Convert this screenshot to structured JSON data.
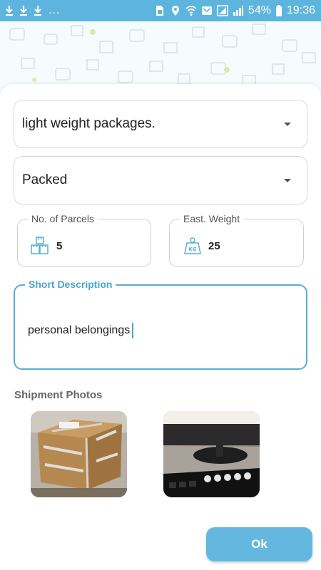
{
  "status_bar": {
    "dots": "...",
    "battery": "54%",
    "time": "19:36"
  },
  "form": {
    "category_select": {
      "value": "light weight packages."
    },
    "status_select": {
      "value": "Packed"
    },
    "parcels": {
      "label": "No. of Parcels",
      "value": "5",
      "icon": "boxes-icon"
    },
    "weight": {
      "label": "East. Weight",
      "value": "25",
      "icon": "kg-weight-icon"
    },
    "description": {
      "label": "Short Description",
      "value": "personal belongings"
    }
  },
  "photos": {
    "label": "Shipment Photos"
  },
  "actions": {
    "ok_label": "Ok"
  },
  "colors": {
    "accent": "#5db4dc",
    "button": "#64b8e0"
  }
}
